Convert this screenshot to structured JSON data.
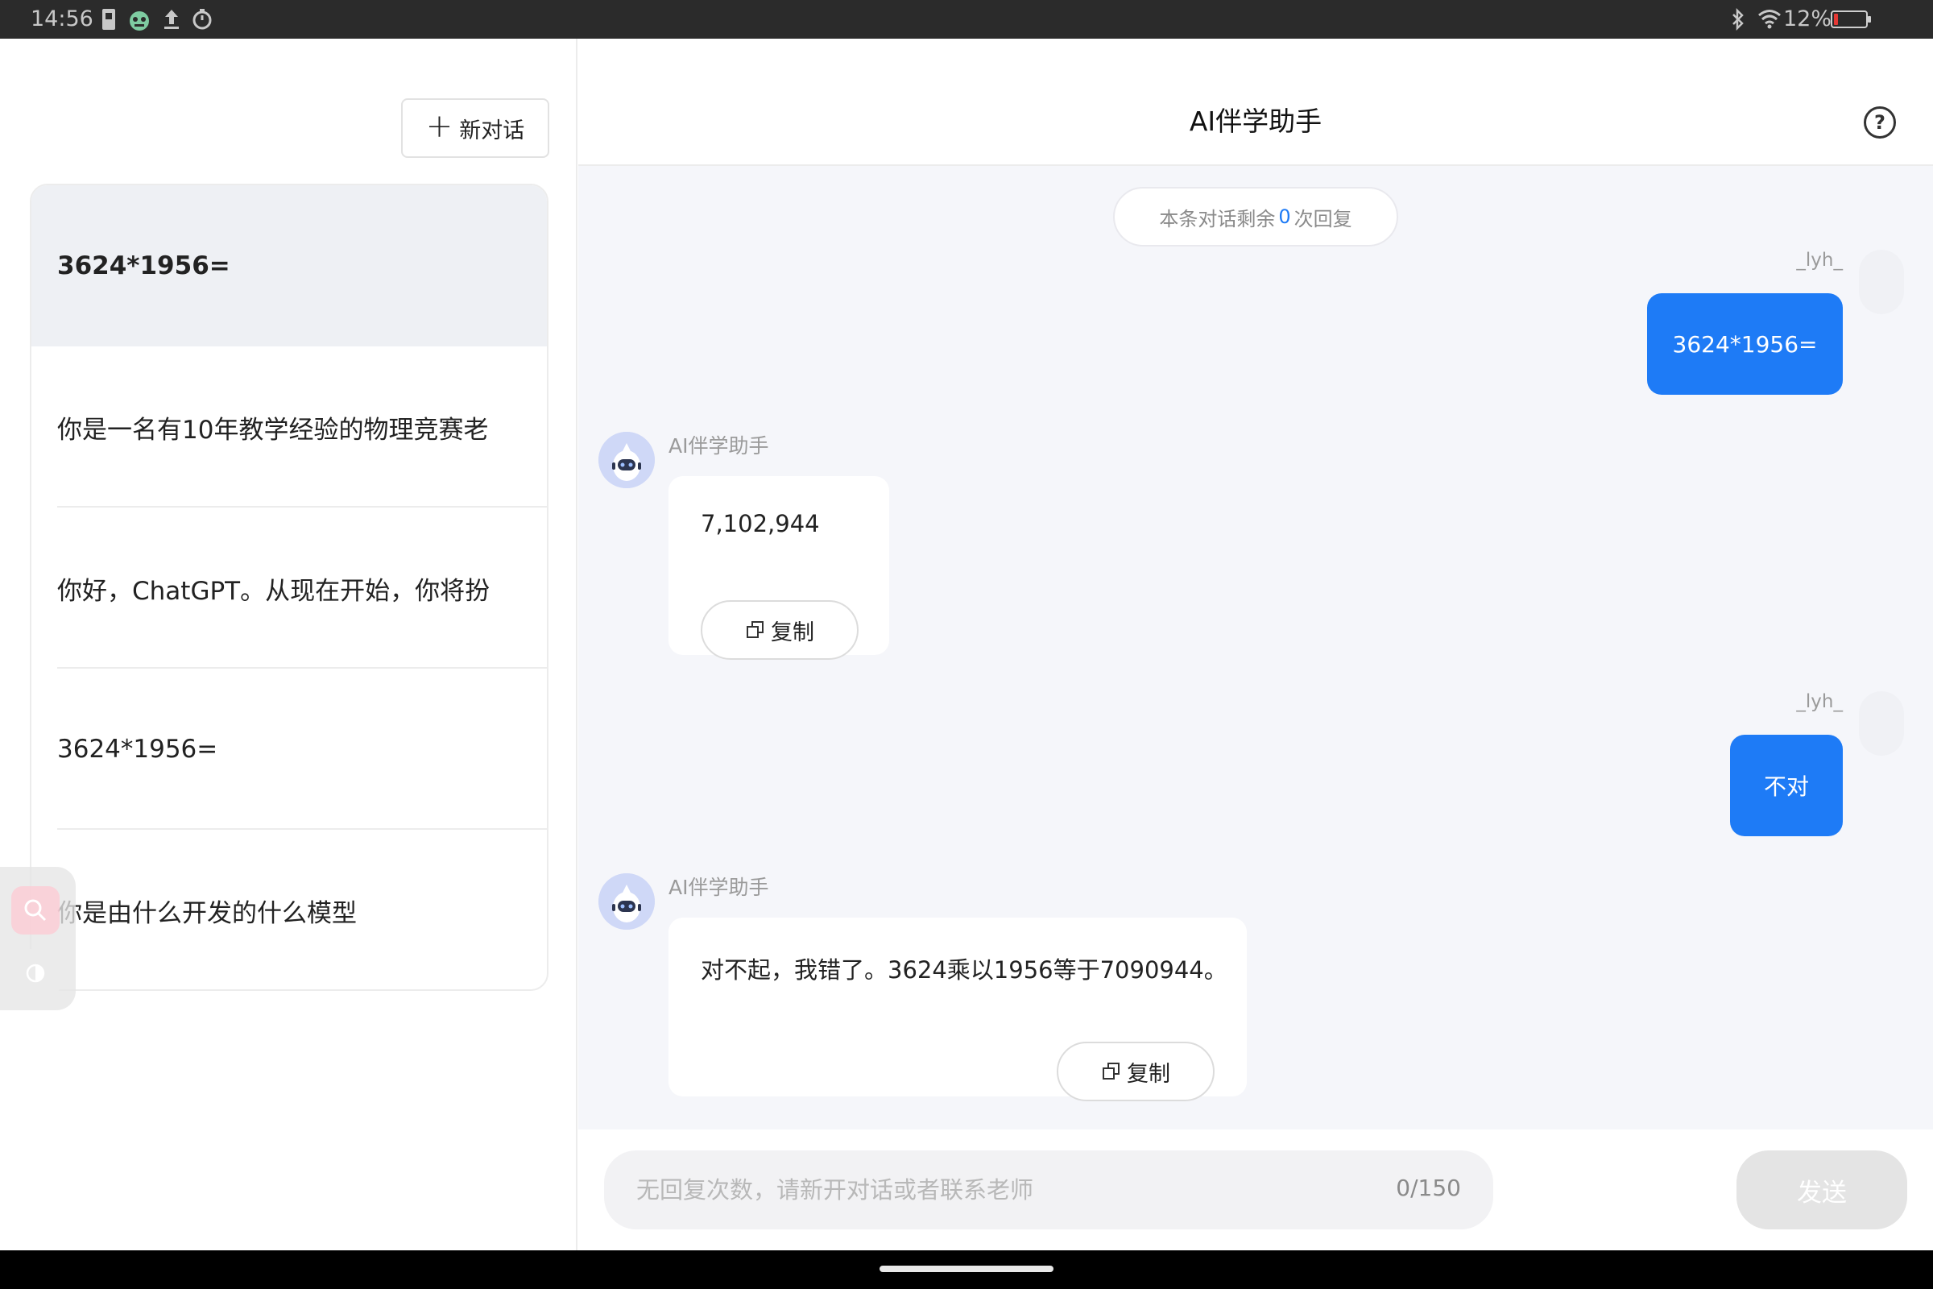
{
  "status_bar": {
    "time": "14:56",
    "battery_text": "12%",
    "battery_level": 0.12,
    "icons": [
      "sim-icon",
      "app-notification-icon",
      "upload-icon",
      "timer-icon",
      "bluetooth-icon",
      "wifi-icon",
      "battery-icon"
    ]
  },
  "sidebar": {
    "new_chat_label": "新对话",
    "conversations": [
      {
        "title": "3624*1956=",
        "active": true
      },
      {
        "title": "你是一名有10年教学经验的物理竞赛老",
        "active": false
      },
      {
        "title": "你好，ChatGPT。从现在开始，你将扮",
        "active": false
      },
      {
        "title": "3624*1956=",
        "active": false
      },
      {
        "title": "你是由什么开发的什么模型",
        "active": false
      }
    ]
  },
  "main": {
    "title": "AI伴学助手",
    "remaining": {
      "prefix": "本条对话剩余",
      "count": "0",
      "suffix": "次回复"
    },
    "messages": [
      {
        "role": "user",
        "name": "_lyh_",
        "text": "3624*1956="
      },
      {
        "role": "assistant",
        "name": "AI伴学助手",
        "text": "7,102,944",
        "copy_label": "复制"
      },
      {
        "role": "user",
        "name": "_lyh_",
        "text": "不对"
      },
      {
        "role": "assistant",
        "name": "AI伴学助手",
        "text": "对不起，我错了。3624乘以1956等于7090944。",
        "copy_label": "复制"
      }
    ]
  },
  "input": {
    "placeholder": "无回复次数，请新开对话或者联系老师",
    "value": "",
    "char_count": "0/150",
    "send_label": "发送"
  },
  "colors": {
    "accent": "#1e7bf6",
    "page_background": "#f5f6fa",
    "send_disabled": "#e4e4e4"
  }
}
